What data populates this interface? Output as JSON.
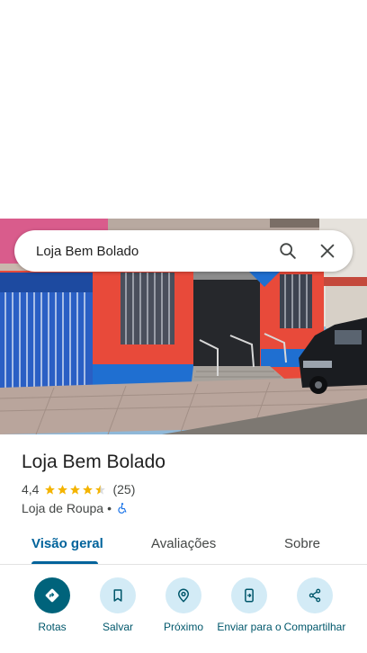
{
  "search": {
    "query": "Loja Bem Bolado"
  },
  "place": {
    "name": "Loja Bem Bolado",
    "rating": "4,4",
    "review_count": "(25)",
    "stars": 4.4,
    "category": "Loja de Roupa",
    "separator": "•"
  },
  "tabs": [
    {
      "label": "Visão geral",
      "active": true
    },
    {
      "label": "Avaliações",
      "active": false
    },
    {
      "label": "Sobre",
      "active": false
    }
  ],
  "actions": [
    {
      "label": "Rotas",
      "icon": "directions-icon"
    },
    {
      "label": "Salvar",
      "icon": "bookmark-icon"
    },
    {
      "label": "Próximo",
      "icon": "nearby-icon"
    },
    {
      "label": "Enviar para o",
      "icon": "send-to-phone-icon"
    },
    {
      "label": "Compartilhar",
      "icon": "share-icon"
    }
  ],
  "colors": {
    "accent": "#00639b",
    "primary_action": "#00637b",
    "action_bg": "#d3ebf6",
    "star": "#f4b400",
    "storefront_wall": "#e84a3a",
    "storefront_trim": "#1f6fd1"
  }
}
